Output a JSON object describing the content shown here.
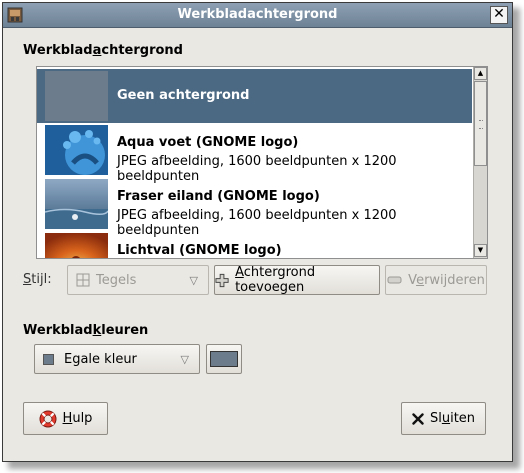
{
  "window": {
    "title": "Werkbladachtergrond",
    "close_glyph": "✕"
  },
  "section_background": {
    "pre": "Werkblad",
    "accel": "a",
    "post": "chtergrond"
  },
  "wallpapers": [
    {
      "name": "Geen achtergrond",
      "desc": "",
      "selected": true
    },
    {
      "name": "Aqua voet (GNOME logo)",
      "desc": "JPEG afbeelding, 1600 beeldpunten x 1200 beeldpunten",
      "selected": false
    },
    {
      "name": "Fraser eiland (GNOME logo)",
      "desc": "JPEG afbeelding, 1600 beeldpunten x 1200 beeldpunten",
      "selected": false
    },
    {
      "name": "Lichtval (GNOME logo)",
      "desc": "",
      "selected": false
    }
  ],
  "style": {
    "label_accel": "S",
    "label_rest": "tijl:",
    "value": "Tegels",
    "add_accel": "A",
    "add_rest": "chtergrond toevoegen",
    "remove_pre": "V",
    "remove_accel": "e",
    "remove_rest": "rwijderen"
  },
  "section_colors": {
    "pre": "Werkblad",
    "accel": "k",
    "post": "leuren"
  },
  "colors": {
    "mode": "Egale kleur",
    "swatch": "#6d7c8c"
  },
  "footer": {
    "help_accel": "H",
    "help_rest": "ulp",
    "close_pre": "Sl",
    "close_accel": "u",
    "close_rest": "iten"
  },
  "icons": [
    "app-icon",
    "close-icon",
    "tiles-icon",
    "add-icon",
    "remove-icon",
    "help-icon",
    "close-x-icon"
  ]
}
